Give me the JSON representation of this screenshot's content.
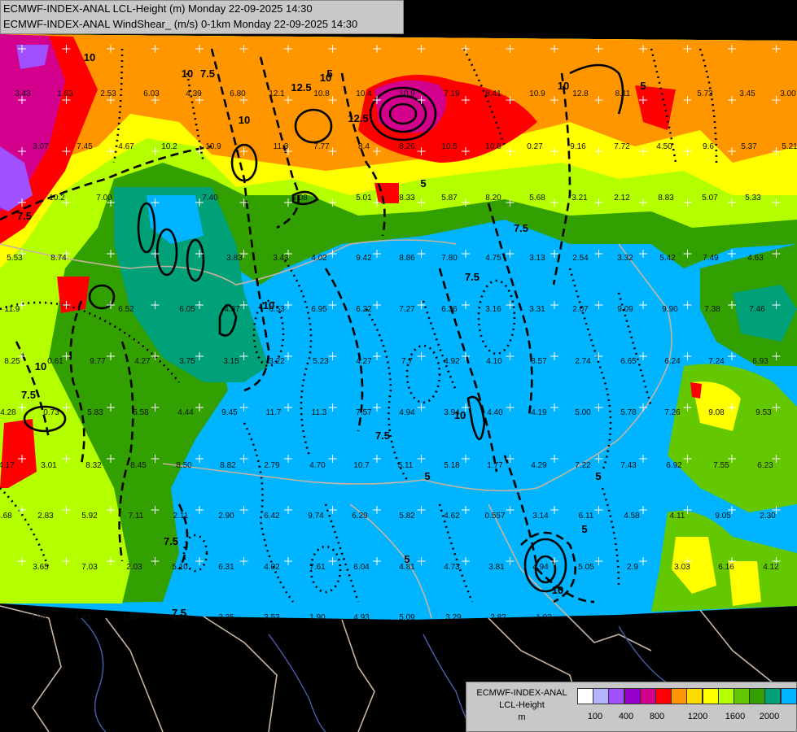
{
  "header": {
    "line1": "ECMWF-INDEX-ANAL LCL-Height (m) Monday 22-09-2025 14:30",
    "line2": "ECMWF-INDEX-ANAL WindShear_ (m/s) 0-1km Monday 22-09-2025 14:30"
  },
  "legend": {
    "title1": "ECMWF-INDEX-ANAL",
    "title2": "LCL-Height",
    "unit": "m",
    "colors": [
      "#ffffff",
      "#b4b4ff",
      "#a050ff",
      "#9600c8",
      "#d2008c",
      "#ff0000",
      "#ff9600",
      "#ffdc00",
      "#ffff00",
      "#b4ff00",
      "#64c800",
      "#32a000",
      "#00a078",
      "#00b4ff"
    ],
    "labels": [
      "100",
      "400",
      "800",
      "1200",
      "1600",
      "2000"
    ]
  },
  "colors": {
    "background": "#000000",
    "border_lines": "#c8b4a0",
    "rivers": "#4a5fa8"
  },
  "values": [
    "3.43",
    "1.63",
    "2.53",
    "6.03",
    "4.39",
    "6.80",
    "12.1",
    "10.8",
    "10.4",
    "10.9",
    "7.19",
    "8.41",
    "10.9",
    "12.8",
    "8.11",
    "5.73",
    "3.45",
    "3.00",
    "3.07",
    "7.45",
    "4.67",
    "10.2",
    "10.9",
    "11.3",
    "7.77",
    "8.4",
    "8.26",
    "10.5",
    "10.8",
    "0.27",
    "9.16",
    "7.72",
    "4.50",
    "9.6",
    "5.37",
    "5.21",
    "10.2",
    "7.00",
    "7.40",
    "6.08",
    "5.01",
    "8.33",
    "5.87",
    "8.20",
    "5.68",
    "3.21",
    "2.12",
    "8.83",
    "5.07",
    "5.33",
    "5.53",
    "8.74",
    "3.83",
    "3.43",
    "4.02",
    "9.42",
    "8.86",
    "7.80",
    "4.75",
    "3.13",
    "2.54",
    "3.32",
    "5.42",
    "7.49",
    "4.63",
    "11.9",
    "6.52",
    "6.05",
    "4.37",
    "6.53",
    "6.95",
    "6.22",
    "7.27",
    "6.36",
    "3.16",
    "3.31",
    "2.07",
    "9.09",
    "9.90",
    "7.38",
    "7.46",
    "8.25",
    "0.61",
    "9.77",
    "4.27",
    "3.75",
    "3.15",
    "3.22",
    "5.23",
    "4.27",
    "7.7",
    "4.92",
    "4.10",
    "3.57",
    "2.74",
    "6.65",
    "6.24",
    "7.24",
    "6.93",
    "4.28",
    "0.73",
    "5.83",
    "5.58",
    "4.44",
    "9.45",
    "11.7",
    "11.3",
    "7.57",
    "4.94",
    "3.94",
    "4.40",
    "4.19",
    "5.00",
    "5.78",
    "7.26",
    "9.08",
    "9.53",
    "4.17",
    "3.01",
    "8.32",
    "8.45",
    "8.50",
    "8.82",
    "2.79",
    "4.70",
    "10.7",
    "5.11",
    "5.18",
    "1.77",
    "4.29",
    "7.22",
    "7.43",
    "6.92",
    "7.55",
    "6.23",
    "4.68",
    "2.83",
    "5.92",
    "7.11",
    "2.11",
    "2.90",
    "6.42",
    "9.74",
    "6.29",
    "5.82",
    "4.62",
    "0.557",
    "3.14",
    "6.11",
    "4.58",
    "4.11",
    "9.05",
    "2.30",
    "3.65",
    "7.03",
    "2.03",
    "5.10",
    "6.31",
    "4.02",
    "7.61",
    "6.04",
    "4.81",
    "4.73",
    "3.81",
    "4.94",
    "5.05",
    "2.9",
    "3.03",
    "6.16",
    "4.12",
    "1.25",
    "1.92",
    "2.20",
    "1.68",
    "3.35",
    "3.53",
    "1.90",
    "4.93",
    "5.09",
    "3.29",
    "2.82",
    "1.93"
  ],
  "contour_labels": [
    "7.5",
    "10",
    "12.5",
    "10",
    "5",
    "7.5",
    "10",
    "5",
    "7.5",
    "10",
    "12.5",
    "5",
    "10",
    "7.5",
    "10",
    "7.5",
    "5",
    "7.5",
    "10",
    "5",
    "10",
    "7.5",
    "5",
    "10",
    "5",
    "7.5",
    "5"
  ]
}
